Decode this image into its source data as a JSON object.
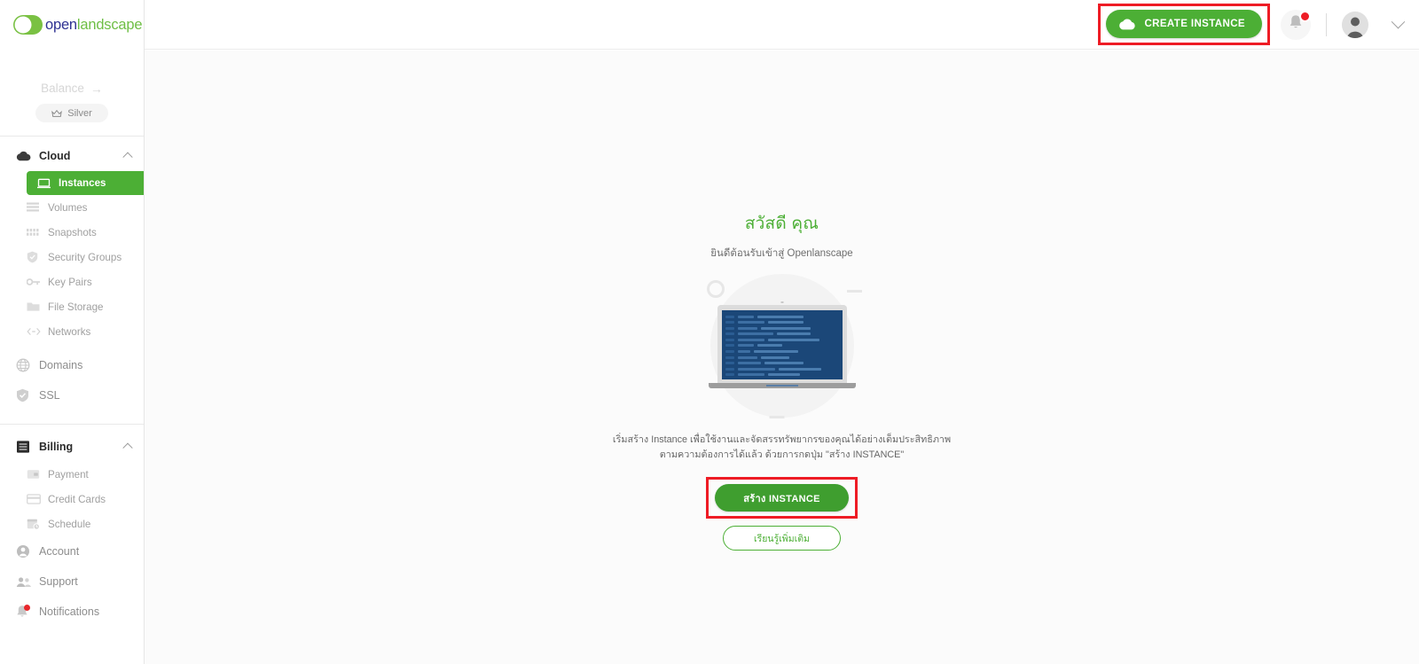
{
  "brand": {
    "logo_open": "open",
    "logo_landscape": "landscape",
    "logo_icon": "leaf-circle-logo",
    "accent_green": "#4caf35",
    "logo_blue": "#2e3192",
    "highlight_red": "#ee1c25"
  },
  "sidebar": {
    "balance_label": "Balance",
    "balance_arrow": "→",
    "tier": "Silver",
    "tier_icon": "crown-icon",
    "groups": [
      {
        "label": "Cloud",
        "icon": "cloud-icon",
        "expanded": true,
        "chevron": "chevron-up-icon",
        "items": [
          {
            "label": "Instances",
            "icon": "monitor-icon",
            "active": true
          },
          {
            "label": "Volumes",
            "icon": "layers-icon",
            "active": false
          },
          {
            "label": "Snapshots",
            "icon": "grid-icon",
            "active": false
          },
          {
            "label": "Security Groups",
            "icon": "shield-icon",
            "active": false
          },
          {
            "label": "Key Pairs",
            "icon": "key-icon",
            "active": false
          },
          {
            "label": "File Storage",
            "icon": "folder-icon",
            "active": false
          },
          {
            "label": "Networks",
            "icon": "code-brackets-icon",
            "active": false
          }
        ]
      },
      {
        "label": "Billing",
        "icon": "receipt-icon",
        "expanded": true,
        "chevron": "chevron-up-icon",
        "items": [
          {
            "label": "Payment",
            "icon": "wallet-icon",
            "active": false
          },
          {
            "label": "Credit Cards",
            "icon": "credit-card-icon",
            "active": false
          },
          {
            "label": "Schedule",
            "icon": "calendar-clock-icon",
            "active": false
          }
        ]
      }
    ],
    "top_links": [
      {
        "label": "Domains",
        "icon": "globe-icon"
      },
      {
        "label": "SSL",
        "icon": "shield-check-icon"
      }
    ],
    "bottom_links": [
      {
        "label": "Account",
        "icon": "user-circle-icon",
        "badge": false
      },
      {
        "label": "Support",
        "icon": "people-icon",
        "badge": false
      },
      {
        "label": "Notifications",
        "icon": "bell-icon",
        "badge": true
      }
    ]
  },
  "topbar": {
    "create_button": "CREATE INSTANCE",
    "create_icon": "cloud-icon",
    "notification_icon": "bell-icon",
    "notification_badge": true,
    "avatar_icon": "user-avatar",
    "caret_icon": "chevron-down-icon"
  },
  "main": {
    "greeting": "สวัสดี คุณ",
    "welcome": "ยินดีต้อนรับเข้าสู่ Openlanscape",
    "illustration": "laptop-code-illustration",
    "description_line1": "เริ่มสร้าง Instance เพื่อใช้งานและจัดสรรทรัพยากรของคุณได้อย่างเต็มประสิทธิภาพ",
    "description_line2": "ตามความต้องการได้แล้ว ด้วยการกดปุ่ม \"สร้าง INSTANCE\"",
    "primary_button": "สร้าง INSTANCE",
    "secondary_button": "เรียนรู้เพิ่มเติม"
  }
}
